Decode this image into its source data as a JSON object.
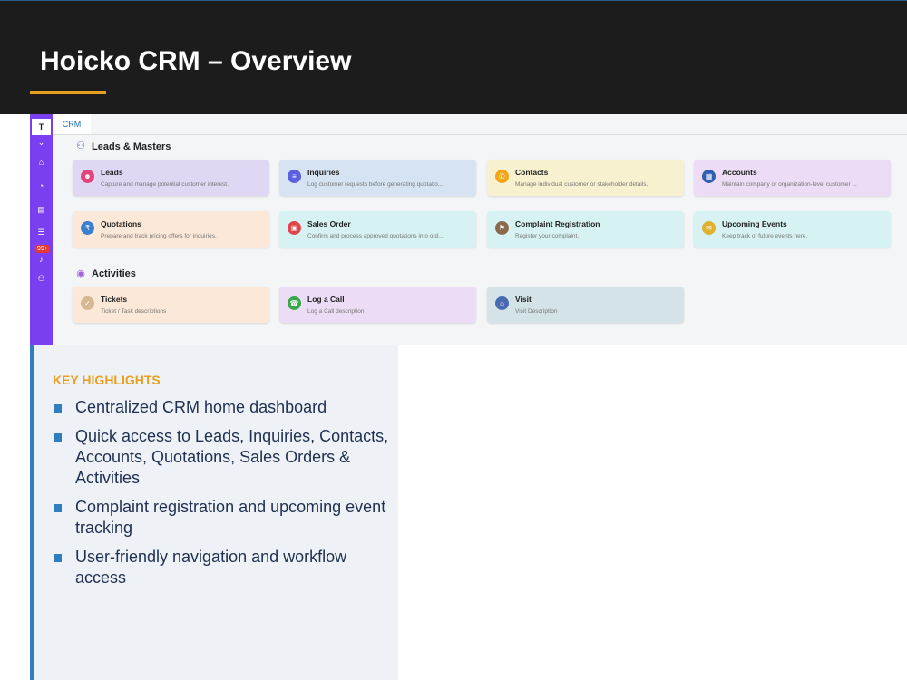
{
  "slide": {
    "title": "Hoicko CRM – Overview"
  },
  "app": {
    "sidebar": {
      "workspace_letter": "T",
      "badge": "99+",
      "icons": [
        "chevron-down-icon",
        "home-icon",
        "dashboard-icon",
        "book-icon",
        "list-icon",
        "bell-icon",
        "users-icon"
      ]
    },
    "tab_label": "CRM",
    "sections": [
      {
        "title": "Leads & Masters",
        "cards": [
          {
            "title": "Leads",
            "desc": "Capture and manage potential customer interest.",
            "icon": "leads-icon",
            "bg": "#e0d7f5",
            "accent": "#e0457b"
          },
          {
            "title": "Inquiries",
            "desc": "Log customer requests before generating quotatio...",
            "icon": "inquiries-icon",
            "bg": "#d5e3f2",
            "accent": "#5b5fe0"
          },
          {
            "title": "Contacts",
            "desc": "Manage individual customer or stakeholder details.",
            "icon": "contacts-icon",
            "bg": "#f8f1cf",
            "accent": "#f2a516"
          },
          {
            "title": "Accounts",
            "desc": "Maintain company or organization-level customer ...",
            "icon": "accounts-icon",
            "bg": "#ecdcf5",
            "accent": "#2f5fb0"
          },
          {
            "title": "Quotations",
            "desc": "Prepare and track pricing offers for inquiries.",
            "icon": "quotations-icon",
            "bg": "#fbe8d8",
            "accent": "#3a7fd0"
          },
          {
            "title": "Sales Order",
            "desc": "Confirm and process approved quotations into ord...",
            "icon": "sales-order-icon",
            "bg": "#d6f2f2",
            "accent": "#e0454b"
          },
          {
            "title": "Complaint Registration",
            "desc": "Register your complaint.",
            "icon": "complaint-icon",
            "bg": "#d6f2f2",
            "accent": "#8a6a4a"
          },
          {
            "title": "Upcoming Events",
            "desc": "Keep track of future events here.",
            "icon": "events-icon",
            "bg": "#d6f2f2",
            "accent": "#e0b030"
          }
        ]
      },
      {
        "title": "Activities",
        "cards": [
          {
            "title": "Tickets",
            "desc": "Ticket / Task descriptions",
            "icon": "tickets-icon",
            "bg": "#fbe8d8",
            "accent": "#d8b890"
          },
          {
            "title": "Log a Call",
            "desc": "Log a Call description",
            "icon": "phone-icon",
            "bg": "#ecdcf5",
            "accent": "#3aa84a"
          },
          {
            "title": "Visit",
            "desc": "Visit Description",
            "icon": "visit-icon",
            "bg": "#d3e3e8",
            "accent": "#4a6ab0"
          }
        ]
      }
    ]
  },
  "highlights": {
    "heading": "KEY HIGHLIGHTS",
    "items": [
      "Centralized CRM home dashboard",
      "Quick access to Leads, Inquiries, Contacts, Accounts, Quotations, Sales Orders & Activities",
      "Complaint registration and upcoming event tracking",
      "User-friendly navigation and workflow access"
    ]
  },
  "colors": {
    "header_bg": "#1c1c1c",
    "accent_orange": "#e8a020",
    "sidebar_purple": "#7b3ff2",
    "bullet_blue": "#2f7fc0"
  }
}
